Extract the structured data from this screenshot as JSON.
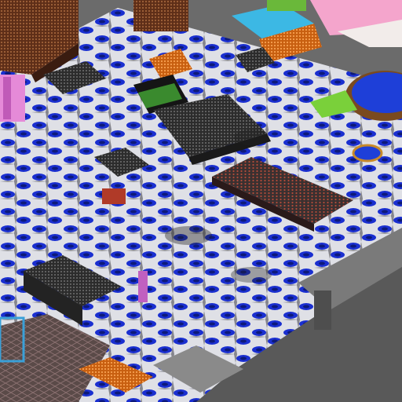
{
  "scene": {
    "title": "",
    "palette": {
      "floor_blue": "#1a2fd0",
      "floor_white": "#e9e9ee",
      "floor_dark": "#2a2a33",
      "void_gray": "#6d6d6d",
      "pool_blue": "#1c3fd6",
      "orange": "#e2791f",
      "brick": "#7a3f22",
      "pink": "#f2a0c8",
      "cyan": "#38b6e0",
      "green": "#64b832",
      "machine_dark": "#3c3c3c"
    }
  }
}
